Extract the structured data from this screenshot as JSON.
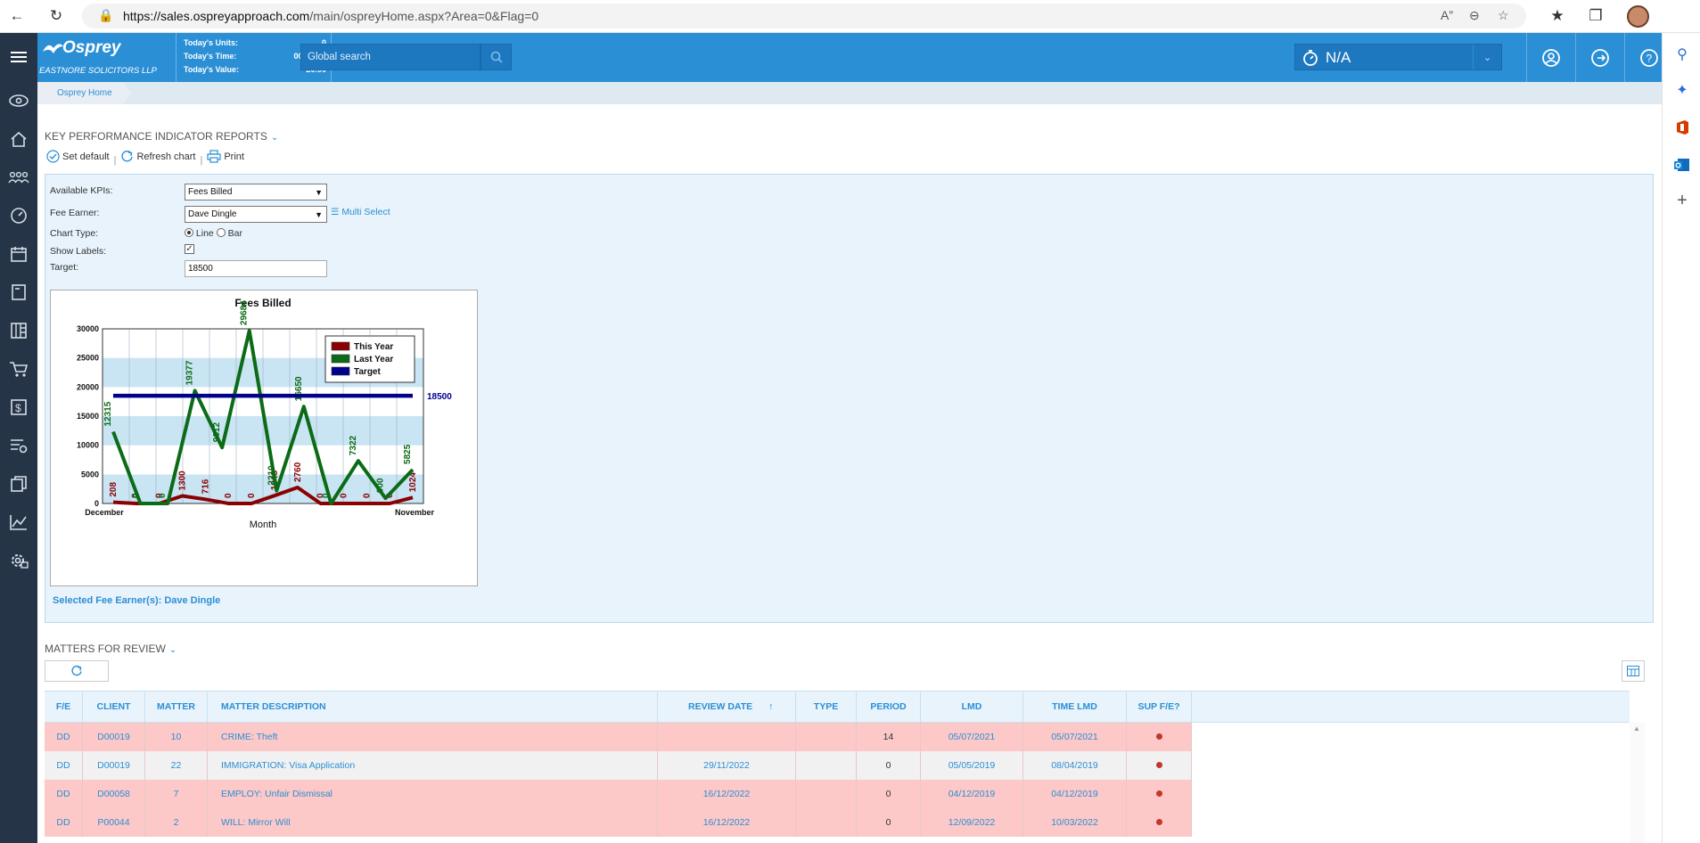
{
  "browser": {
    "url_host": "https://sales.ospreyapproach.com",
    "url_rest": "/main/ospreyHome.aspx?Area=0&Flag=0"
  },
  "header": {
    "brand": "Osprey",
    "firm": "EASTNORE SOLICITORS LLP",
    "stats": [
      {
        "label": "Today's Units:",
        "value": "0"
      },
      {
        "label": "Today's Time:",
        "value": "00h:00m"
      },
      {
        "label": "Today's Value:",
        "value": "£0.00"
      }
    ],
    "search_placeholder": "Global search",
    "timer": "N/A"
  },
  "breadcrumb": "Osprey Home",
  "kpi": {
    "title": "KEY PERFORMANCE INDICATOR REPORTS",
    "tools": {
      "set_default": "Set default",
      "refresh": "Refresh chart",
      "print": "Print"
    },
    "labels": {
      "available": "Available KPIs:",
      "fee_earner": "Fee Earner:",
      "chart_type": "Chart Type:",
      "show_labels": "Show Labels:",
      "target": "Target:"
    },
    "available_value": "Fees Billed",
    "fee_earner_value": "Dave Dingle",
    "multi_select": "Multi Select",
    "chart_line": "Line",
    "chart_bar": "Bar",
    "target_value": "18500",
    "selected": "Selected Fee Earner(s): Dave Dingle"
  },
  "chart_data": {
    "type": "line",
    "title": "Fees Billed",
    "xlabel": "Month",
    "ylabel": "",
    "x_first": "December",
    "x_last": "November",
    "ylim": [
      0,
      30000
    ],
    "yticks": [
      "30000",
      "25000",
      "20000",
      "15000",
      "10000",
      "5000",
      "0"
    ],
    "legend": [
      "This Year",
      "Last Year",
      "Target"
    ],
    "legend_position": "top-right",
    "target_label": "18500",
    "series": [
      {
        "name": "This Year",
        "color": "#8b0000",
        "values": [
          208,
          0,
          0,
          1300,
          716,
          0,
          0,
          1348,
          2760,
          0,
          0,
          0,
          0,
          1024
        ],
        "labels": [
          "208",
          "0",
          "0",
          "1300",
          "716",
          "0",
          "0",
          "1348",
          "2760",
          "0",
          "0",
          "0",
          "0",
          "1024"
        ]
      },
      {
        "name": "Last Year",
        "color": "#0b6b16",
        "values": [
          12315,
          0,
          0,
          19377,
          9612,
          29684,
          2210,
          16650,
          0,
          7322,
          900,
          5825
        ],
        "labels": [
          "12315",
          "0",
          "0",
          "19377",
          "9612",
          "29684",
          "2210",
          "16650",
          "0",
          "7322",
          "900",
          "5825"
        ]
      },
      {
        "name": "Target",
        "color": "#00008b",
        "values": [
          18500,
          18500
        ]
      }
    ]
  },
  "mfr": {
    "title": "MATTERS FOR REVIEW",
    "columns": [
      "F/E",
      "CLIENT",
      "MATTER",
      "MATTER DESCRIPTION",
      "REVIEW DATE",
      "TYPE",
      "PERIOD",
      "LMD",
      "TIME LMD",
      "SUP F/E?"
    ],
    "rows": [
      {
        "fe": "DD",
        "client": "D00019",
        "matter": "10",
        "desc": "CRIME: Theft",
        "review": "",
        "type": "",
        "period": "14",
        "lmd": "05/07/2021",
        "tlmd": "05/07/2021",
        "bg": "#fcc8c8"
      },
      {
        "fe": "DD",
        "client": "D00019",
        "matter": "22",
        "desc": "IMMIGRATION: Visa Application",
        "review": "29/11/2022",
        "type": "",
        "period": "0",
        "lmd": "05/05/2019",
        "tlmd": "08/04/2019",
        "bg": "#f1f1f1"
      },
      {
        "fe": "DD",
        "client": "D00058",
        "matter": "7",
        "desc": "EMPLOY: Unfair Dismissal",
        "review": "16/12/2022",
        "type": "",
        "period": "0",
        "lmd": "04/12/2019",
        "tlmd": "04/12/2019",
        "bg": "#fcc8c8"
      },
      {
        "fe": "DD",
        "client": "P00044",
        "matter": "2",
        "desc": "WILL: Mirror Will",
        "review": "16/12/2022",
        "type": "",
        "period": "0",
        "lmd": "12/09/2022",
        "tlmd": "10/03/2022",
        "bg": "#fcc8c8"
      }
    ]
  }
}
